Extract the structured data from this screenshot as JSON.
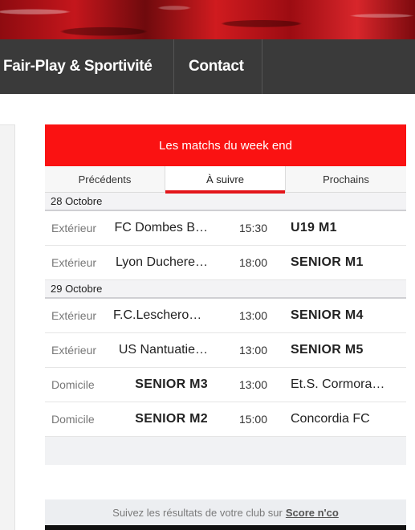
{
  "nav": {
    "items": [
      {
        "label": "Fair-Play & Sportivité"
      },
      {
        "label": "Contact"
      }
    ]
  },
  "widget": {
    "title": "Les matchs du week end",
    "tabs": [
      {
        "label": "Précédents",
        "active": false
      },
      {
        "label": "À suivre",
        "active": true
      },
      {
        "label": "Prochains",
        "active": false
      }
    ],
    "groups": [
      {
        "date": "28 Octobre",
        "matches": [
          {
            "venue": "Extérieur",
            "home": "FC Dombes B…",
            "time": "15:30",
            "away": "U19 M1",
            "bold_side": "away"
          },
          {
            "venue": "Extérieur",
            "home": "Lyon Duchere…",
            "time": "18:00",
            "away": "SENIOR M1",
            "bold_side": "away"
          }
        ]
      },
      {
        "date": "29 Octobre",
        "matches": [
          {
            "venue": "Extérieur",
            "home": "F.C.Lescherou…",
            "time": "13:00",
            "away": "SENIOR M4",
            "bold_side": "away"
          },
          {
            "venue": "Extérieur",
            "home": "US Nantuatie…",
            "time": "13:00",
            "away": "SENIOR M5",
            "bold_side": "away"
          },
          {
            "venue": "Domicile",
            "home": "SENIOR M3",
            "time": "13:00",
            "away": "Et.S. Cormora…",
            "bold_side": "home"
          },
          {
            "venue": "Domicile",
            "home": "SENIOR M2",
            "time": "15:00",
            "away": "Concordia FC",
            "bold_side": "home"
          }
        ]
      }
    ]
  },
  "footer": {
    "text": "Suivez les résultats de votre club sur",
    "link_label": "Score n'co"
  },
  "colors": {
    "accent": "#fa1212",
    "nav_bg": "#3a3a3a"
  }
}
